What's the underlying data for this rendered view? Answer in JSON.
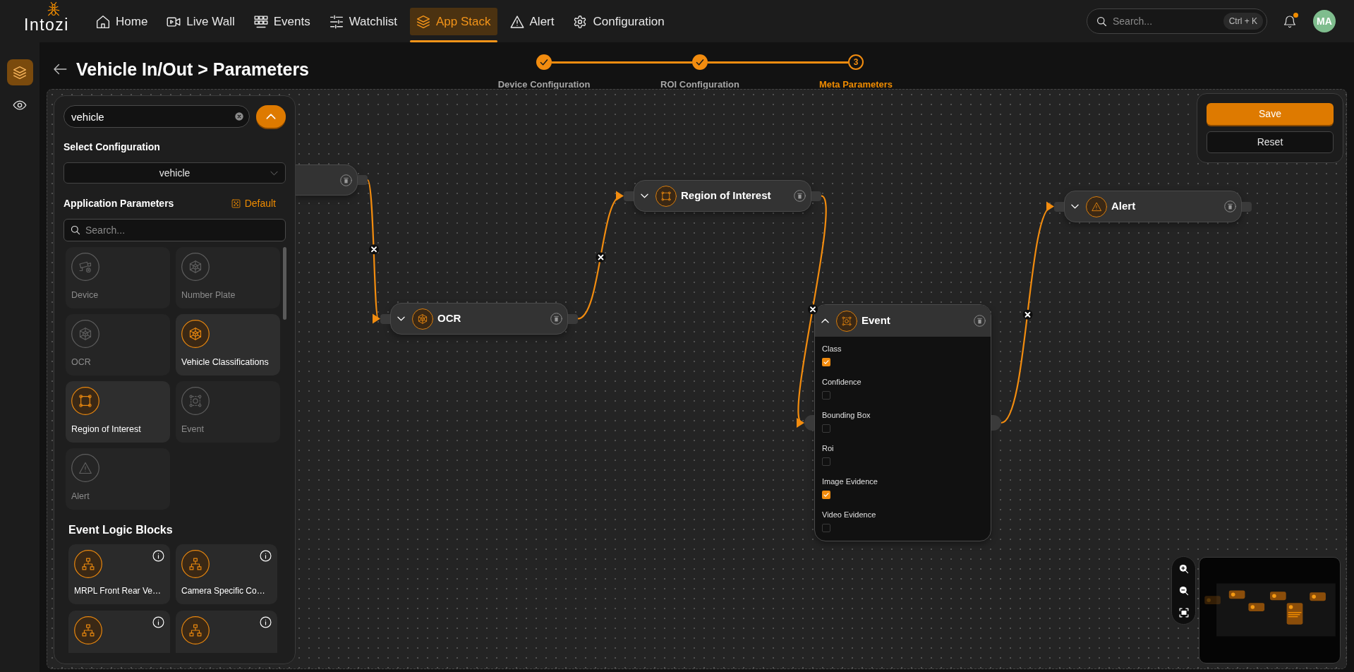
{
  "header": {
    "logo": "Intozi",
    "nav": [
      {
        "label": "Home",
        "selected": false
      },
      {
        "label": "Live Wall",
        "selected": false
      },
      {
        "label": "Events",
        "selected": false
      },
      {
        "label": "Watchlist",
        "selected": false
      },
      {
        "label": "App Stack",
        "selected": true
      },
      {
        "label": "Alert",
        "selected": false
      },
      {
        "label": "Configuration",
        "selected": false
      }
    ],
    "search": {
      "placeholder": "Search...",
      "shortcut": "Ctrl + K"
    },
    "notifications": {
      "unread": true
    },
    "avatar": "MA"
  },
  "rail": [
    {
      "selected": true
    },
    {
      "selected": false
    }
  ],
  "page": {
    "title": "Vehicle In/Out > Parameters"
  },
  "stepper": [
    {
      "label": "Device Configuration",
      "completed": true,
      "selected": false
    },
    {
      "label": "ROI Configuration",
      "completed": true,
      "selected": false
    },
    {
      "label": "Meta Parameters",
      "number": "3",
      "completed": false,
      "selected": true
    }
  ],
  "panel": {
    "search": {
      "value": "vehicle"
    },
    "config_label": "Select Configuration",
    "config_select": {
      "value": "vehicle"
    },
    "params_heading": "Application Parameters",
    "default_link": "Default",
    "params_search": {
      "placeholder": "Search..."
    },
    "parameters": [
      {
        "label": "Device",
        "disabled": true
      },
      {
        "label": "Number Plate",
        "disabled": true
      },
      {
        "label": "OCR",
        "disabled": true
      },
      {
        "label": "Vehicle Classifications",
        "disabled": false
      },
      {
        "label": "Region of Interest",
        "disabled": false
      },
      {
        "label": "Event",
        "disabled": true
      },
      {
        "label": "Alert",
        "disabled": true
      }
    ],
    "logic_heading": "Event Logic Blocks",
    "logic_blocks": [
      {
        "kind": "full",
        "label": "MRPL Front Rear Ve…"
      },
      {
        "kind": "full",
        "label": "Camera Specific Co…"
      },
      {
        "kind": "partial"
      },
      {
        "kind": "partial"
      }
    ]
  },
  "flow": {
    "nodes": [
      {
        "kind": "stub"
      },
      {
        "kind": "block",
        "label": "OCR",
        "expanded": false
      },
      {
        "kind": "block",
        "label": "Region of Interest",
        "expanded": false
      },
      {
        "kind": "block",
        "label": "Event",
        "expanded": true,
        "fields": [
          {
            "label": "Class",
            "checked": true
          },
          {
            "label": "Confidence",
            "checked": false
          },
          {
            "label": "Bounding Box",
            "checked": false
          },
          {
            "label": "Roi",
            "checked": false
          },
          {
            "label": "Image Evidence",
            "checked": true
          },
          {
            "label": "Video Evidence",
            "checked": false
          }
        ]
      },
      {
        "kind": "block",
        "label": "Alert",
        "expanded": false
      }
    ]
  },
  "actions": [
    {
      "label": "Save",
      "kind": "primary"
    },
    {
      "label": "Reset",
      "kind": "secondary"
    }
  ]
}
